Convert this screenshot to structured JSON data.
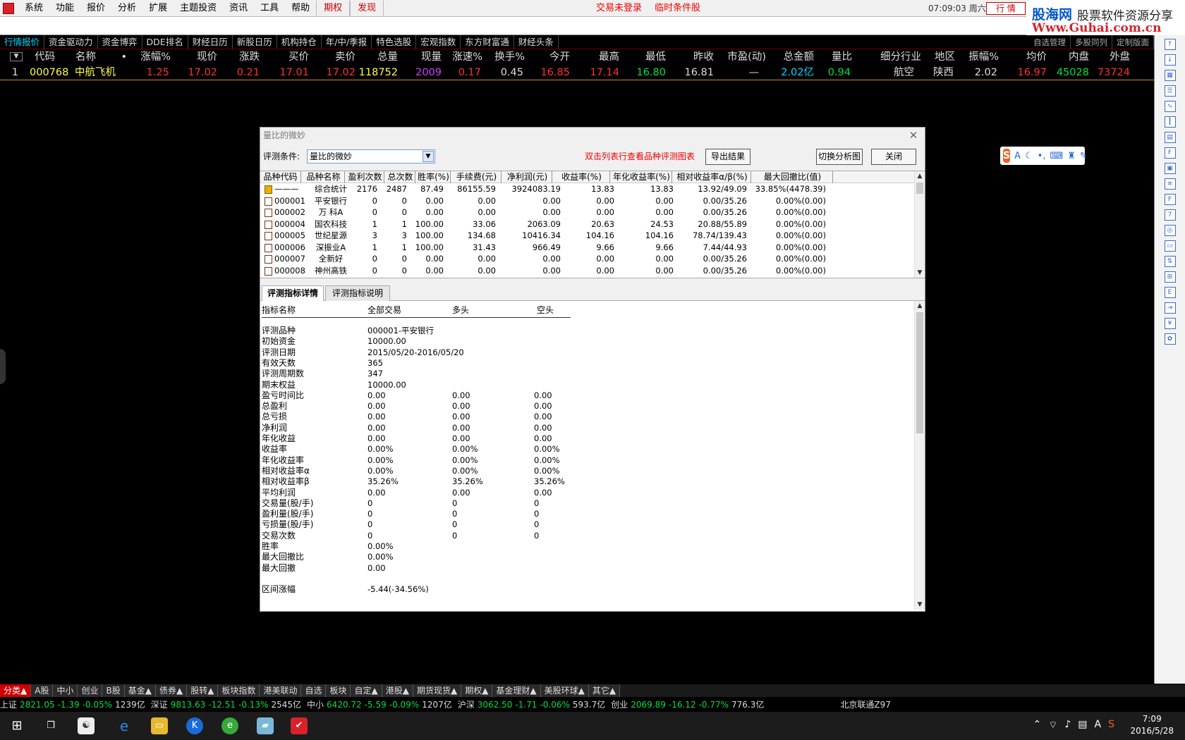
{
  "menubar": {
    "items": [
      "系统",
      "功能",
      "报价",
      "分析",
      "扩展",
      "主题投资",
      "资讯",
      "工具",
      "帮助"
    ],
    "red_items": [
      "期权",
      "发现"
    ],
    "center_notices": [
      "交易未登录",
      "临时条件股"
    ],
    "clock": "07:09:03 周六",
    "hq_button": "行 情"
  },
  "brand": {
    "line1": "股海网",
    "line2": "股票软件资源分享",
    "line3": "Www.Guhai.com.cn"
  },
  "tabs": [
    "行情报价",
    "资金驱动力",
    "资金博弈",
    "DDE排名",
    "财经日历",
    "新股日历",
    "机构持仓",
    "年/中/季报",
    "特色选股",
    "宏观指数",
    "东方财富通",
    "财经头条"
  ],
  "tabs_right": [
    "自选管理",
    "多股同列",
    "定制版面"
  ],
  "quote": {
    "headers": [
      "代码",
      "名称",
      "•",
      "涨幅%",
      "现价",
      "涨跌",
      "买价",
      "卖价",
      "总量",
      "现量",
      "涨速%",
      "换手%",
      "今开",
      "最高",
      "最低",
      "昨收",
      "市盈(动)",
      "总金额",
      "量比",
      "细分行业",
      "地区",
      "振幅%",
      "均价",
      "内盘",
      "外盘"
    ],
    "row": {
      "index": "1",
      "code": "000768",
      "name": "中航飞机",
      "dot": "",
      "pct": "1.25",
      "price": "17.02",
      "change": "0.21",
      "bid": "17.01",
      "ask": "17.02",
      "volume": "118752",
      "cur_vol": "2009",
      "speed": "0.17",
      "turnover": "0.45",
      "open": "16.85",
      "high": "17.14",
      "low": "16.80",
      "prev_close": "16.81",
      "pe": "—",
      "amount": "2.02亿",
      "vol_ratio": "0.94",
      "industry": "航空",
      "region": "陕西",
      "amplitude": "2.02",
      "avg": "16.97",
      "inner": "45028",
      "outer": "73724"
    }
  },
  "dialog": {
    "title": "量比的微妙",
    "cond_label": "评测条件:",
    "cond_value": "量比的微妙",
    "hint": "双击列表行查看品种评测图表",
    "export_btn": "导出结果",
    "switch_btn": "切换分析图",
    "close_btn": "关闭",
    "table": {
      "headers": [
        "品种代码",
        "品种名称",
        "盈利次数",
        "总次数",
        "胜率(%)",
        "手续费(元)",
        "净利润(元)",
        "收益率(%)",
        "年化收益率(%)",
        "相对收益率α/β(%)",
        "最大回撤比(值)"
      ],
      "rows": [
        [
          "———",
          "综合统计",
          "2176",
          "2487",
          "87.49",
          "86155.59",
          "3924083.19",
          "13.83",
          "13.83",
          "13.92/49.09",
          "33.85%(4478.39)"
        ],
        [
          "000001",
          "平安银行",
          "0",
          "0",
          "0.00",
          "0.00",
          "0.00",
          "0.00",
          "0.00",
          "0.00/35.26",
          "0.00%(0.00)"
        ],
        [
          "000002",
          "万  科A",
          "0",
          "0",
          "0.00",
          "0.00",
          "0.00",
          "0.00",
          "0.00",
          "0.00/35.26",
          "0.00%(0.00)"
        ],
        [
          "000004",
          "国农科技",
          "1",
          "1",
          "100.00",
          "33.06",
          "2063.09",
          "20.63",
          "24.53",
          "20.88/55.89",
          "0.00%(0.00)"
        ],
        [
          "000005",
          "世纪星源",
          "3",
          "3",
          "100.00",
          "134.68",
          "10416.34",
          "104.16",
          "104.16",
          "78.74/139.43",
          "0.00%(0.00)"
        ],
        [
          "000006",
          "深振业A",
          "1",
          "1",
          "100.00",
          "31.43",
          "966.49",
          "9.66",
          "9.66",
          "7.44/44.93",
          "0.00%(0.00)"
        ],
        [
          "000007",
          "全新好",
          "0",
          "0",
          "0.00",
          "0.00",
          "0.00",
          "0.00",
          "0.00",
          "0.00/35.26",
          "0.00%(0.00)"
        ],
        [
          "000008",
          "神州高铁",
          "0",
          "0",
          "0.00",
          "0.00",
          "0.00",
          "0.00",
          "0.00",
          "0.00/35.26",
          "0.00%(0.00)"
        ]
      ]
    },
    "detail_tabs": [
      "评测指标详情",
      "评测指标说明"
    ],
    "detail_headers": [
      "指标名称",
      "全部交易",
      "多头",
      "空头"
    ],
    "detail_rows": [
      [
        "评测品种",
        "000001-平安银行",
        "",
        ""
      ],
      [
        "初始资金",
        "10000.00",
        "",
        ""
      ],
      [
        "评测日期",
        "2015/05/20-2016/05/20",
        "",
        ""
      ],
      [
        "有效天数",
        "365",
        "",
        ""
      ],
      [
        "评测周期数",
        "347",
        "",
        ""
      ],
      [
        "期末权益",
        "10000.00",
        "",
        ""
      ],
      [
        "盈亏时间比",
        "0.00",
        "0.00",
        "0.00"
      ],
      [
        "总盈利",
        "0.00",
        "0.00",
        "0.00"
      ],
      [
        "总亏损",
        "0.00",
        "0.00",
        "0.00"
      ],
      [
        "净利润",
        "0.00",
        "0.00",
        "0.00"
      ],
      [
        "年化收益",
        "0.00",
        "0.00",
        "0.00"
      ],
      [
        "收益率",
        "0.00%",
        "0.00%",
        "0.00%"
      ],
      [
        "年化收益率",
        "0.00%",
        "0.00%",
        "0.00%"
      ],
      [
        "相对收益率α",
        "0.00%",
        "0.00%",
        "0.00%"
      ],
      [
        "相对收益率β",
        "35.26%",
        "35.26%",
        "35.26%"
      ],
      [
        "平均利润",
        "0.00",
        "0.00",
        "0.00"
      ],
      [
        "交易量(股/手)",
        "0",
        "0",
        "0"
      ],
      [
        "盈利量(股/手)",
        "0",
        "0",
        "0"
      ],
      [
        "亏损量(股/手)",
        "0",
        "0",
        "0"
      ],
      [
        "交易次数",
        "0",
        "0",
        "0"
      ],
      [
        "胜率",
        "0.00%",
        "",
        ""
      ],
      [
        "最大回撤比",
        "0.00%",
        "",
        ""
      ],
      [
        "最大回撤",
        "0.00",
        "",
        ""
      ],
      [
        "",
        "",
        " ",
        ""
      ],
      [
        "区间涨幅",
        "-5.44(-34.56%)",
        "",
        ""
      ]
    ]
  },
  "bottom_tabs": [
    "分类▲",
    "A股",
    "中小",
    "创业",
    "B股",
    "基金▲",
    "债券▲",
    "股转▲",
    "板块指数",
    "港美联动",
    "自选",
    "板块",
    "自定▲",
    "港股▲",
    "期货现货▲",
    "期权▲",
    "基金理财▲",
    "美股环球▲",
    "其它▲"
  ],
  "indexbar": [
    {
      "name": "上证",
      "val": "2821.05",
      "chg": "-1.39",
      "pct": "-0.05%",
      "amt": "1239亿"
    },
    {
      "name": "深证",
      "val": "9813.63",
      "chg": "-12.51",
      "pct": "-0.13%",
      "amt": "2545亿"
    },
    {
      "name": "中小",
      "val": "6420.72",
      "chg": "-5.59",
      "pct": "-0.09%",
      "amt": "1207亿"
    },
    {
      "name": "沪深",
      "val": "3062.50",
      "chg": "-1.71",
      "pct": "-0.06%",
      "amt": "593.7亿"
    },
    {
      "name": "创业",
      "val": "2069.89",
      "chg": "-16.12",
      "pct": "-0.77%",
      "amt": "776.3亿"
    }
  ],
  "server": "北京联通Z97",
  "taskbar": {
    "time": "7:09",
    "date": "2016/5/28",
    "ime": "A"
  },
  "colors": {
    "up": "#ff3030",
    "down": "#00e040",
    "code": "#ffff40",
    "accent": "#00d8ff",
    "purple": "#d040ff"
  }
}
